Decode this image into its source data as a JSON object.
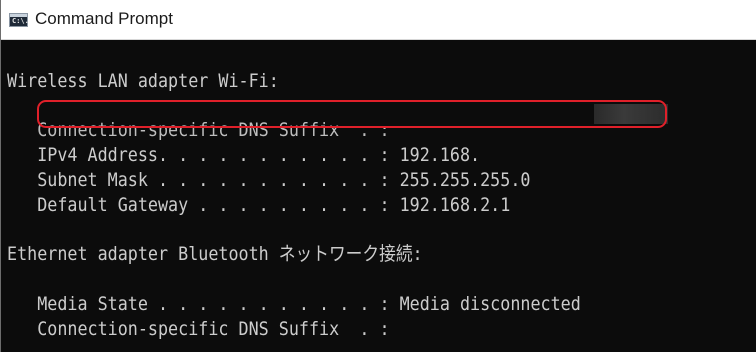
{
  "window": {
    "title": "Command Prompt",
    "icon": "command-prompt-icon",
    "icon_glyph": "C:\\."
  },
  "console": {
    "wifi_header": "Wireless LAN adapter Wi-Fi:",
    "wifi_dns_suffix": "   Connection-specific DNS Suffix  . :",
    "wifi_ipv4": "   IPv4 Address. . . . . . . . . . . : 192.168.",
    "wifi_subnet": "   Subnet Mask . . . . . . . . . . . : 255.255.255.0",
    "wifi_gateway": "   Default Gateway . . . . . . . . . : 192.168.2.1",
    "eth_header": "Ethernet adapter Bluetooth ネットワーク接続:",
    "eth_media_state": "   Media State . . . . . . . . . . . : Media disconnected",
    "eth_dns_suffix": "   Connection-specific DNS Suffix  . :"
  },
  "colors": {
    "console_bg": "#0c0c0c",
    "console_text": "#cccccc",
    "highlight": "#e0202a"
  }
}
